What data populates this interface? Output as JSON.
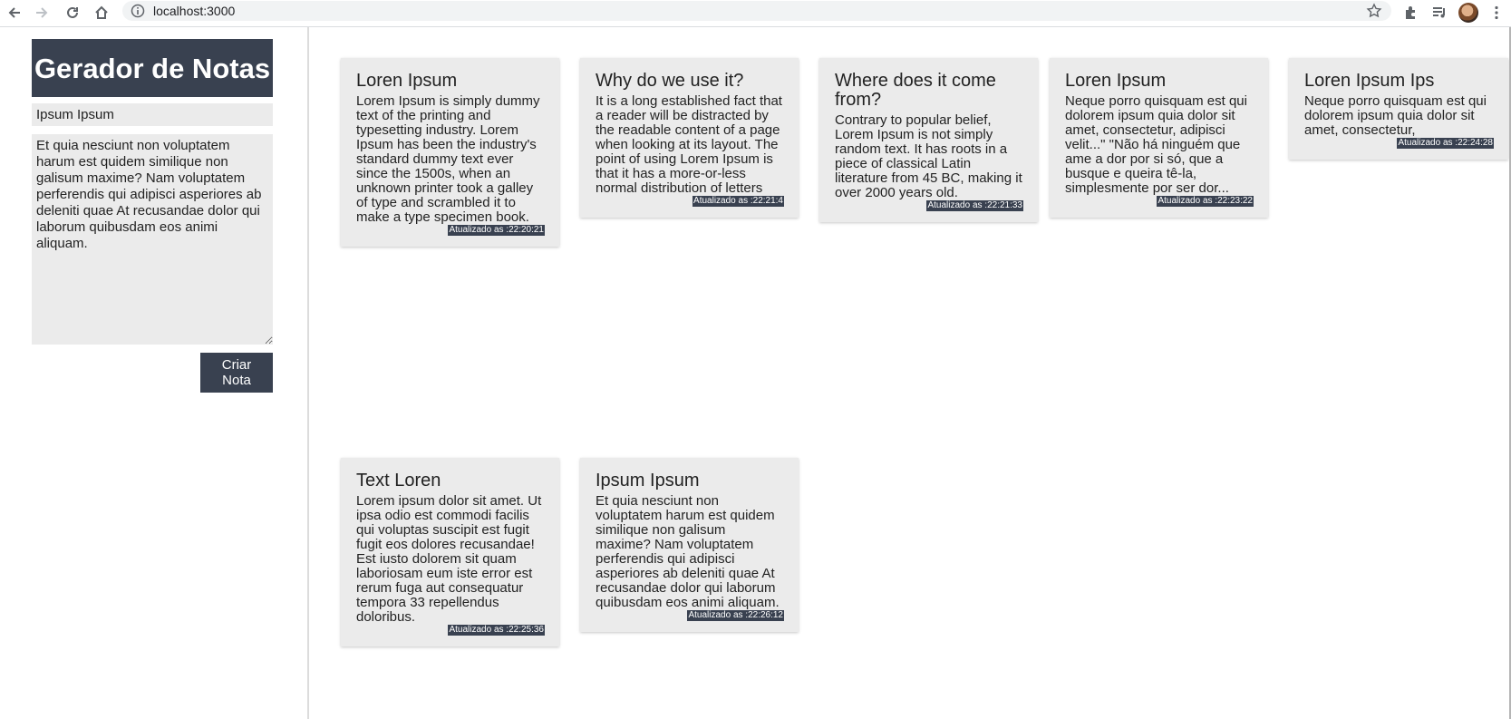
{
  "browser": {
    "url": "localhost:3000"
  },
  "sidebar": {
    "title": "Gerador de Notas",
    "title_input_value": "Ipsum Ipsum",
    "body_textarea_value": "Et quia nesciunt non voluptatem harum est quidem similique non galisum maxime? Nam voluptatem perferendis qui adipisci asperiores ab deleniti quae At recusandae dolor qui laborum quibusdam eos animi aliquam.",
    "create_button_label": "Criar Nota"
  },
  "notes": [
    {
      "title": "Loren Ipsum",
      "body": "Lorem Ipsum is simply dummy text of the printing and typesetting industry. Lorem Ipsum has been the industry's standard dummy text ever since the 1500s, when an unknown printer took a galley of type and scrambled it to make a type specimen book.",
      "updated": "Atualizado as :22:20:21"
    },
    {
      "title": "Why do we use it?",
      "body": "It is a long established fact that a reader will be distracted by the readable content of a page when looking at its layout. The point of using Lorem Ipsum is that it has a more-or-less normal distribution of letters",
      "updated": "Atualizado as :22:21:4"
    },
    {
      "title": "Where does it come from?",
      "body": "Contrary to popular belief, Lorem Ipsum is not simply random text. It has roots in a piece of classical Latin literature from 45 BC, making it over 2000 years old.",
      "updated": "Atualizado as :22:21:33"
    },
    {
      "title": "Loren Ipsum",
      "body": "Neque porro quisquam est qui dolorem ipsum quia dolor sit amet, consectetur, adipisci velit...\" \"Não há ninguém que ame a dor por si só, que a busque e queira tê-la, simplesmente por ser dor...",
      "updated": "Atualizado as :22:23:22"
    },
    {
      "title": "Loren Ipsum Ips",
      "body": "Neque porro quisquam est qui dolorem ipsum quia dolor sit amet, consectetur,",
      "updated": "Atualizado as :22:24:28"
    },
    {
      "title": "Text Loren",
      "body": "Lorem ipsum dolor sit amet. Ut ipsa odio est commodi facilis qui voluptas suscipit est fugit fugit eos dolores recusandae! Est iusto dolorem sit quam laboriosam eum iste error est rerum fuga aut consequatur tempora 33 repellendus doloribus.",
      "updated": "Atualizado as :22:25:36"
    },
    {
      "title": "Ipsum Ipsum",
      "body": "Et quia nesciunt non voluptatem harum est quidem similique non galisum maxime? Nam voluptatem perferendis qui adipisci asperiores ab deleniti quae At recusandae dolor qui laborum quibusdam eos animi aliquam.",
      "updated": "Atualizado as :22:26:12"
    }
  ],
  "colors": {
    "accent": "#394150",
    "card_bg": "#ebebeb",
    "input_bg": "#ebebeb"
  }
}
